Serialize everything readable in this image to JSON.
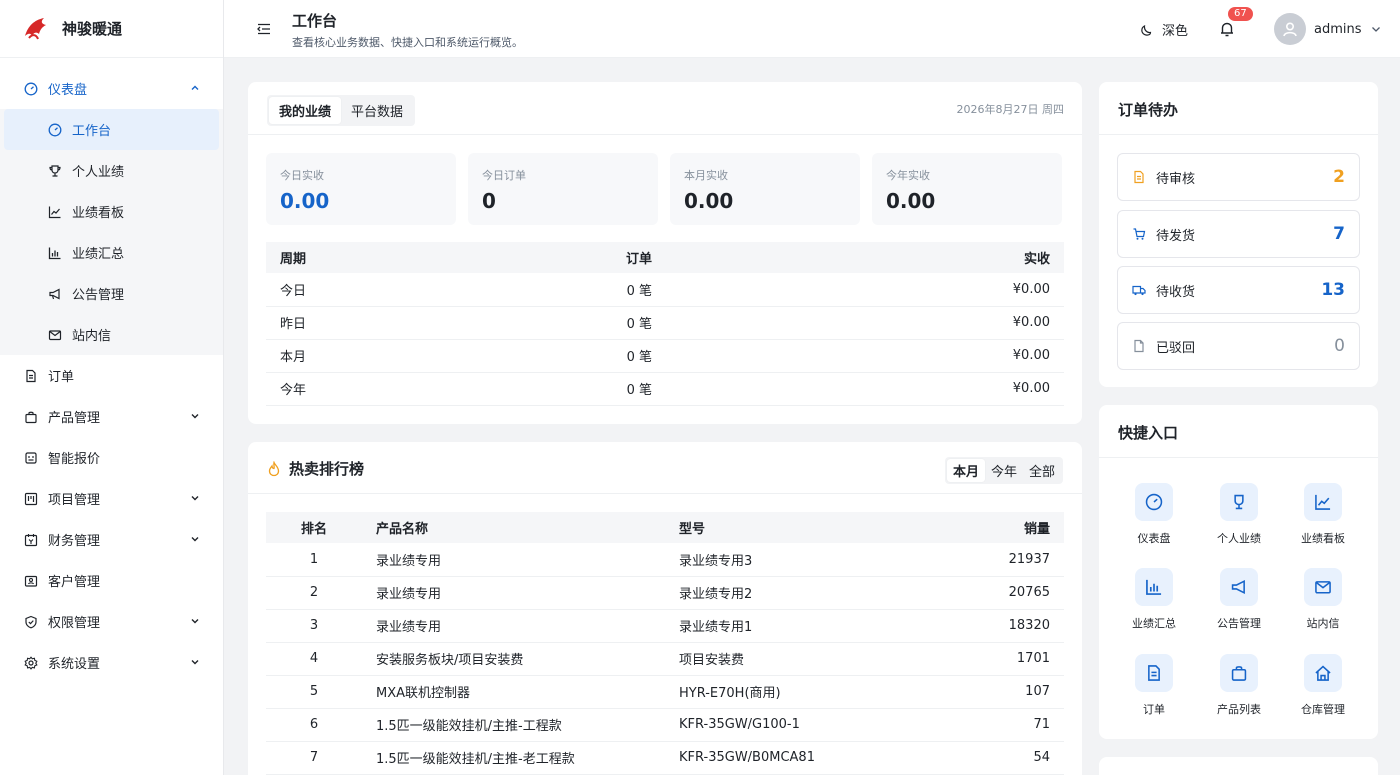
{
  "brand": {
    "name": "神骏暖通"
  },
  "sidebar": {
    "group": {
      "label": "仪表盘"
    },
    "sub_items": [
      {
        "label": "工作台",
        "icon": "dashboard-icon",
        "active": true
      },
      {
        "label": "个人业绩",
        "icon": "trophy-icon"
      },
      {
        "label": "业绩看板",
        "icon": "line-chart-icon"
      },
      {
        "label": "业绩汇总",
        "icon": "bar-chart-icon"
      },
      {
        "label": "公告管理",
        "icon": "megaphone-icon"
      },
      {
        "label": "站内信",
        "icon": "mail-icon"
      }
    ],
    "items": [
      {
        "label": "订单",
        "icon": "document-icon",
        "expandable": false
      },
      {
        "label": "产品管理",
        "icon": "bag-icon",
        "expandable": true
      },
      {
        "label": "智能报价",
        "icon": "robot-icon",
        "expandable": false
      },
      {
        "label": "项目管理",
        "icon": "board-icon",
        "expandable": true
      },
      {
        "label": "财务管理",
        "icon": "calendar-icon",
        "expandable": true
      },
      {
        "label": "客户管理",
        "icon": "id-card-icon",
        "expandable": false
      },
      {
        "label": "权限管理",
        "icon": "shield-icon",
        "expandable": true
      },
      {
        "label": "系统设置",
        "icon": "gear-icon",
        "expandable": true
      }
    ]
  },
  "header": {
    "title": "工作台",
    "subtitle": "查看核心业务数据、快捷入口和系统运行概览。",
    "theme_label": "深色",
    "notification_count": "67",
    "username": "admins"
  },
  "performance": {
    "tabs": [
      "我的业绩",
      "平台数据"
    ],
    "date": "2026年8月27日 周四",
    "stats": [
      {
        "label": "今日实收",
        "value": "0.00"
      },
      {
        "label": "今日订单",
        "value": "0"
      },
      {
        "label": "本月实收",
        "value": "0.00"
      },
      {
        "label": "今年实收",
        "value": "0.00"
      }
    ],
    "columns": [
      "周期",
      "订单",
      "实收"
    ],
    "rows": [
      {
        "period": "今日",
        "orders": "0 笔",
        "revenue": "¥0.00"
      },
      {
        "period": "昨日",
        "orders": "0 笔",
        "revenue": "¥0.00"
      },
      {
        "period": "本月",
        "orders": "0 笔",
        "revenue": "¥0.00"
      },
      {
        "period": "今年",
        "orders": "0 笔",
        "revenue": "¥0.00"
      }
    ]
  },
  "hot": {
    "title": "热卖排行榜",
    "tabs": [
      "本月",
      "今年",
      "全部"
    ],
    "columns": [
      "排名",
      "产品名称",
      "型号",
      "销量"
    ],
    "rows": [
      {
        "rank": "1",
        "name": "录业绩专用",
        "model": "录业绩专用3",
        "sales": "21937"
      },
      {
        "rank": "2",
        "name": "录业绩专用",
        "model": "录业绩专用2",
        "sales": "20765"
      },
      {
        "rank": "3",
        "name": "录业绩专用",
        "model": "录业绩专用1",
        "sales": "18320"
      },
      {
        "rank": "4",
        "name": "安装服务板块/项目安装费",
        "model": "项目安装费",
        "sales": "1701"
      },
      {
        "rank": "5",
        "name": "MXA联机控制器",
        "model": "HYR-E70H(商用)",
        "sales": "107"
      },
      {
        "rank": "6",
        "name": "1.5匹一级能效挂机/主推-工程款",
        "model": "KFR-35GW/G100-1",
        "sales": "71"
      },
      {
        "rank": "7",
        "name": "1.5匹一级能效挂机/主推-老工程款",
        "model": "KFR-35GW/B0MCA81",
        "sales": "54"
      }
    ]
  },
  "todo": {
    "title": "订单待办",
    "items": [
      {
        "label": "待审核",
        "count": "2",
        "color": "#f0a020",
        "icon": "document-icon"
      },
      {
        "label": "待发货",
        "count": "7",
        "color": "#1664c9",
        "icon": "cart-icon"
      },
      {
        "label": "待收货",
        "count": "13",
        "color": "#1664c9",
        "icon": "truck-icon"
      },
      {
        "label": "已驳回",
        "count": "0",
        "color": "#86909c",
        "icon": "file-icon"
      }
    ]
  },
  "quick": {
    "title": "快捷入口",
    "items": [
      {
        "label": "仪表盘",
        "icon": "dashboard-icon"
      },
      {
        "label": "个人业绩",
        "icon": "trophy-icon"
      },
      {
        "label": "业绩看板",
        "icon": "line-chart-icon"
      },
      {
        "label": "业绩汇总",
        "icon": "bar-chart-icon"
      },
      {
        "label": "公告管理",
        "icon": "megaphone-icon"
      },
      {
        "label": "站内信",
        "icon": "mail-icon"
      },
      {
        "label": "订单",
        "icon": "document-icon"
      },
      {
        "label": "产品列表",
        "icon": "bag-icon"
      },
      {
        "label": "仓库管理",
        "icon": "home-icon"
      }
    ]
  },
  "colors": {
    "accent": "#1664c9",
    "badge": "#f0524f"
  }
}
